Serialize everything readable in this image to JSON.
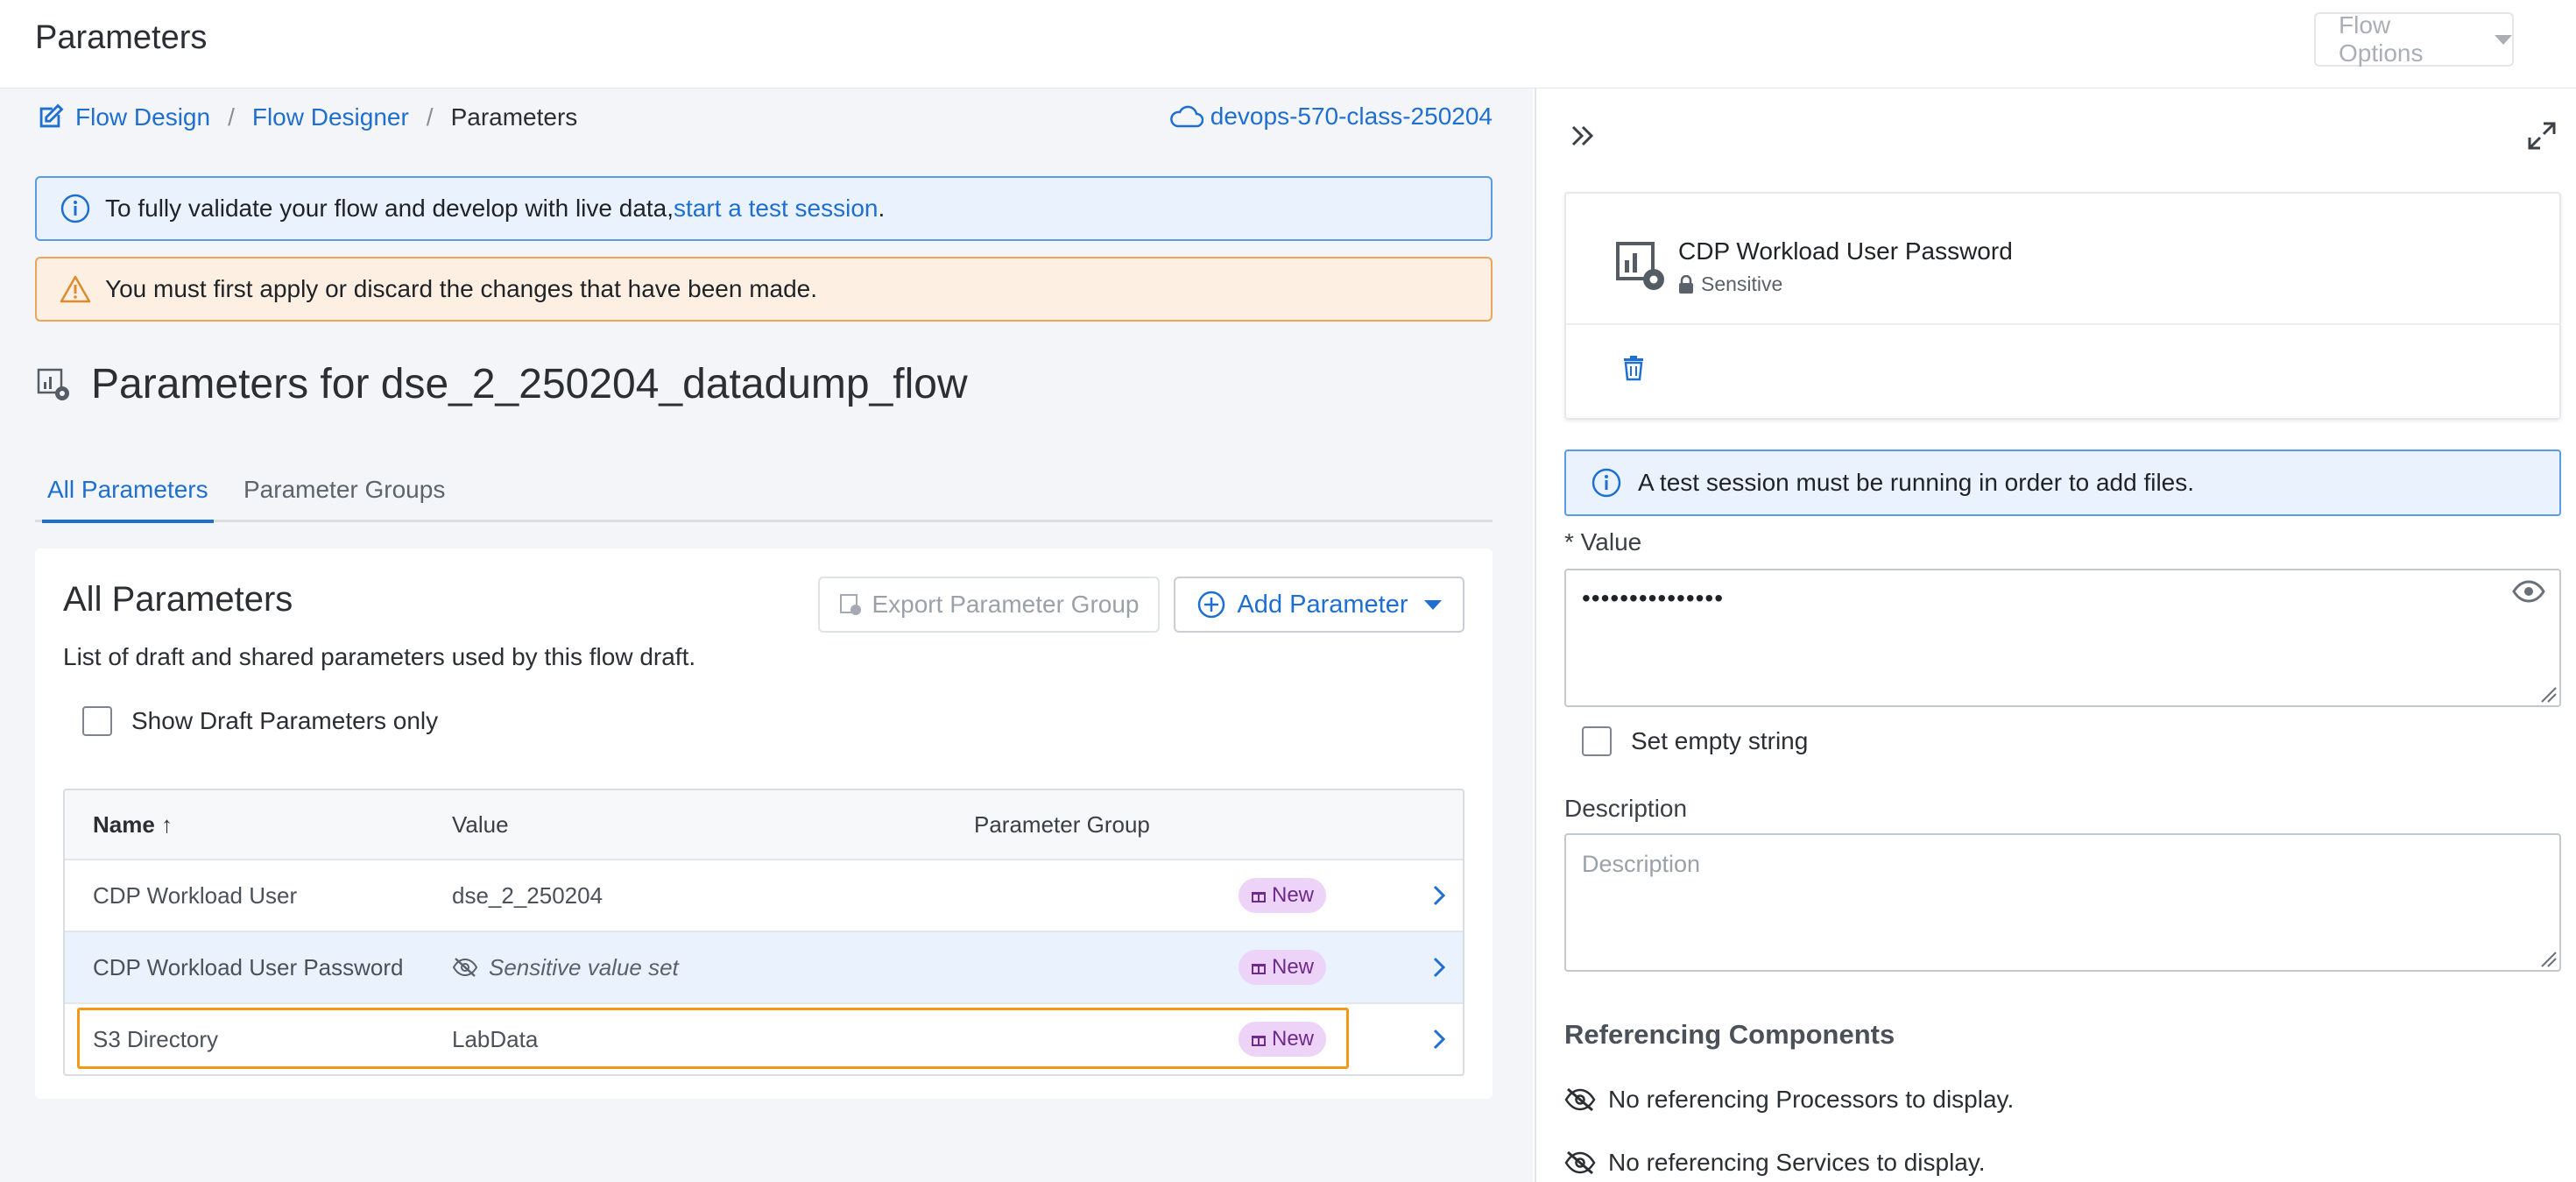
{
  "header": {
    "title": "Parameters",
    "flow_options_label": "Flow Options"
  },
  "breadcrumb": {
    "items": [
      "Flow Design",
      "Flow Designer",
      "Parameters"
    ],
    "separator": "/"
  },
  "workspace": {
    "label": "devops-570-class-250204"
  },
  "alerts": {
    "info_text": "To fully validate your flow and develop with live data, ",
    "info_link": "start a test session",
    "info_suffix": ".",
    "warning_text": "You must first apply or discard the changes that have been made."
  },
  "section": {
    "title": "Parameters for dse_2_250204_datadump_flow"
  },
  "tabs": [
    {
      "label": "All Parameters",
      "active": true
    },
    {
      "label": "Parameter Groups",
      "active": false
    }
  ],
  "card": {
    "title": "All Parameters",
    "description": "List of draft and shared parameters used by this flow draft.",
    "export_button": "Export Parameter Group",
    "add_button": "Add Parameter",
    "show_draft_label": "Show Draft Parameters only"
  },
  "table": {
    "headers": {
      "name": "Name ↑",
      "value": "Value",
      "group": "Parameter Group"
    },
    "rows": [
      {
        "name": "CDP Workload User",
        "value": "dse_2_250204",
        "badge": "New"
      },
      {
        "name": "CDP Workload User Password",
        "value": "Sensitive value set",
        "badge": "New"
      },
      {
        "name": "S3 Directory",
        "value": "LabData",
        "badge": "New"
      }
    ]
  },
  "panel": {
    "component_name": "CDP Workload User Password",
    "sensitive_label": "Sensitive",
    "info_text": "A test session must be running in order to add files.",
    "value_label": "* Value",
    "value_masked": "•••••••••••••••",
    "set_empty_label": "Set empty string",
    "description_label": "Description",
    "description_placeholder": "Description",
    "referencing_title": "Referencing Components",
    "no_processors": "No referencing Processors to display.",
    "no_services": "No referencing Services to display."
  },
  "colors": {
    "link": "#1f6fd1",
    "info_border": "#5a9be6",
    "warning_border": "#eca55a",
    "badge_bg": "#ecd3f7",
    "highlight": "#f29a18"
  }
}
